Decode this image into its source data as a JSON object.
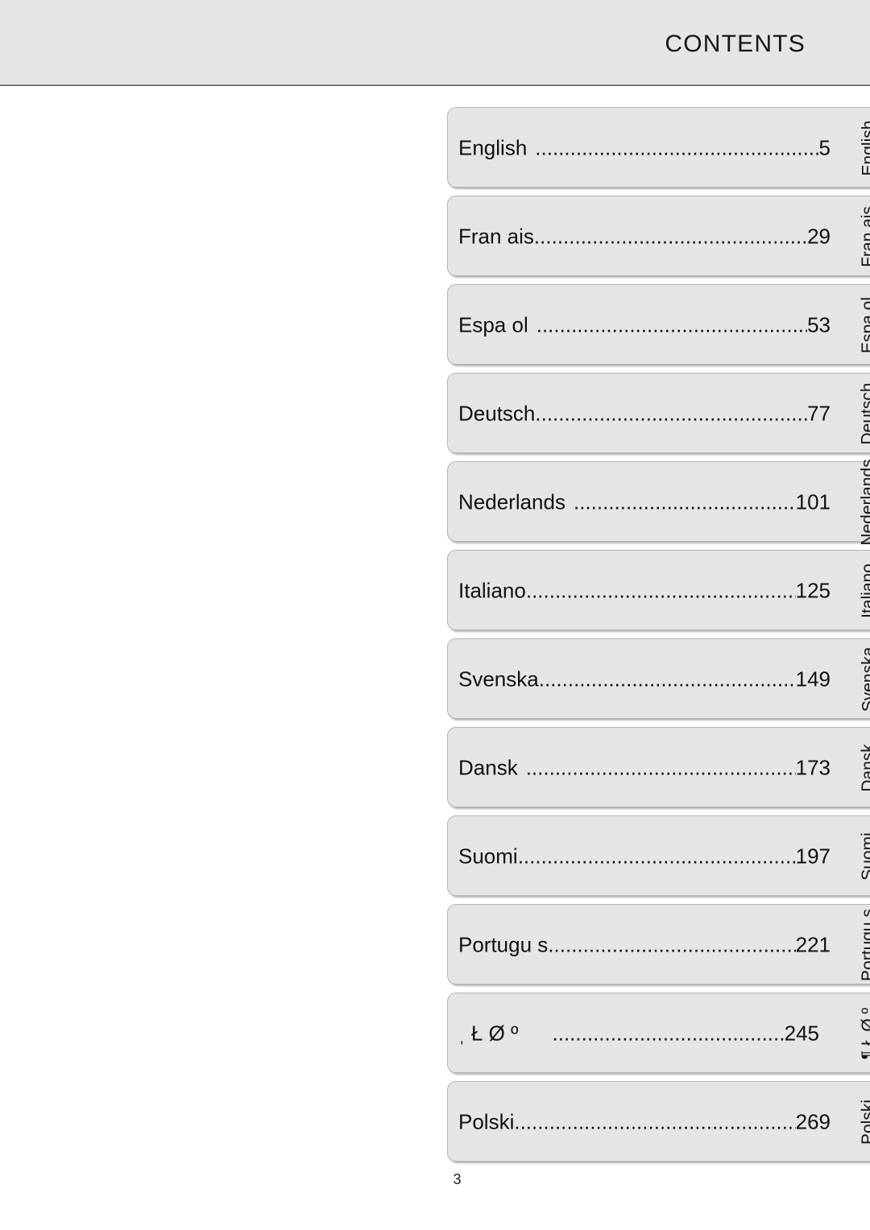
{
  "header": {
    "title": "CONTENTS"
  },
  "leader": {
    "dots": "................................................................................................"
  },
  "toc": {
    "entries": [
      {
        "label": "English",
        "page": "5",
        "tab": "English",
        "gap": "normal"
      },
      {
        "label": "Fran ais",
        "page": "29",
        "tab": "Fran ais",
        "gap": "none"
      },
      {
        "label": "Espa ol",
        "page": "53",
        "tab": "Espa ol",
        "gap": "normal"
      },
      {
        "label": "Deutsch",
        "page": "77",
        "tab": "Deutsch",
        "gap": "none"
      },
      {
        "label": "Nederlands",
        "page": "101",
        "tab": "Nederlands",
        "gap": "normal"
      },
      {
        "label": "Italiano",
        "page": "125",
        "tab": "Italiano",
        "gap": "none"
      },
      {
        "label": "Svenska",
        "page": "149",
        "tab": "Svenska",
        "gap": "none"
      },
      {
        "label": "Dansk",
        "page": "173",
        "tab": "Dansk",
        "gap": "normal"
      },
      {
        "label": "Suomi",
        "page": "197",
        "tab": "Suomi",
        "gap": "none"
      },
      {
        "label": "Portugu s",
        "page": "221",
        "tab": "Portugu s",
        "gap": "none"
      },
      {
        "label": "ˌ Ł Ø º",
        "page": "245",
        "tab": "¶ Ł Ø º",
        "gap": "wide"
      },
      {
        "label": "Polski",
        "page": "269",
        "tab": "Polski",
        "gap": "none"
      }
    ]
  },
  "footer": {
    "folio": "3"
  },
  "colors": {
    "header_band": "#e5e5e5",
    "header_rule": "#777777",
    "row_fill": "#e5e5e5",
    "row_border": "#b4b4b4",
    "text": "#111111",
    "page_background": "#ffffff"
  }
}
